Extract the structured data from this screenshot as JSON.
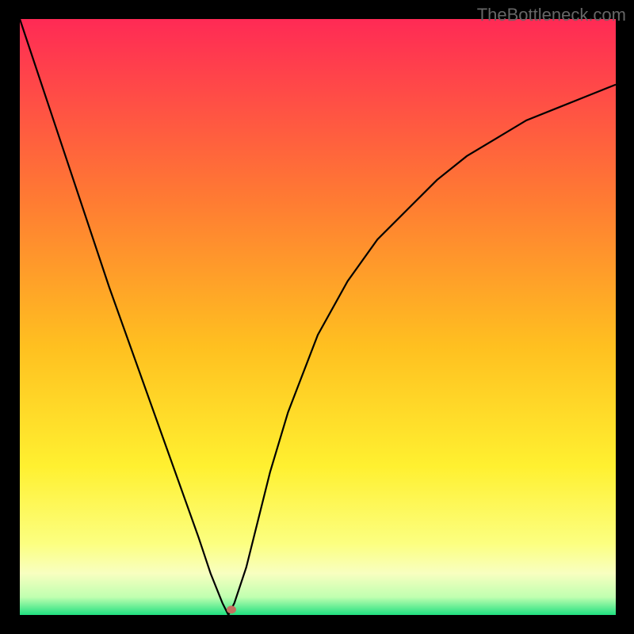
{
  "attribution": "TheBottleneck.com",
  "chart_data": {
    "type": "line",
    "title": "",
    "xlabel": "",
    "ylabel": "",
    "xlim": [
      0,
      100
    ],
    "ylim": [
      0,
      100
    ],
    "x": [
      0,
      5,
      10,
      15,
      20,
      25,
      30,
      32,
      34,
      35,
      36,
      38,
      40,
      42,
      45,
      50,
      55,
      60,
      65,
      70,
      75,
      80,
      85,
      90,
      95,
      100
    ],
    "values": [
      100,
      85,
      70,
      55,
      41,
      27,
      13,
      7,
      2,
      0,
      2,
      8,
      16,
      24,
      34,
      47,
      56,
      63,
      68,
      73,
      77,
      80,
      83,
      85,
      87,
      89
    ],
    "minimum_x": 35,
    "minimum_y": 0,
    "marker": {
      "x": 35.5,
      "y": 0.5
    },
    "background_gradient_stops": [
      {
        "offset": 0.0,
        "color": "#ff2a55"
      },
      {
        "offset": 0.3,
        "color": "#ff7a33"
      },
      {
        "offset": 0.55,
        "color": "#ffc020"
      },
      {
        "offset": 0.75,
        "color": "#fff030"
      },
      {
        "offset": 0.88,
        "color": "#fcff80"
      },
      {
        "offset": 0.93,
        "color": "#f8ffc0"
      },
      {
        "offset": 0.97,
        "color": "#c0ffb0"
      },
      {
        "offset": 1.0,
        "color": "#20e080"
      }
    ]
  }
}
